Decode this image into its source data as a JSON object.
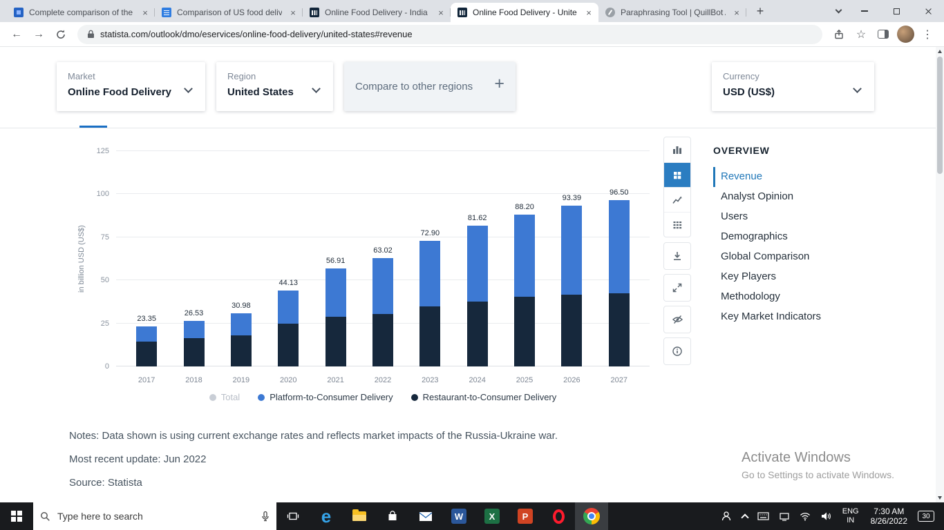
{
  "browser": {
    "tabs": [
      {
        "title": "Complete comparison of the",
        "favicon": "blue-app",
        "active": false
      },
      {
        "title": "Comparison of US food deliv",
        "favicon": "doc",
        "active": false
      },
      {
        "title": "Online Food Delivery - India |",
        "favicon": "statista",
        "active": false
      },
      {
        "title": "Online Food Delivery - Unite",
        "favicon": "statista",
        "active": true
      },
      {
        "title": "Paraphrasing Tool | QuillBot A",
        "favicon": "quillbot",
        "active": false
      }
    ],
    "url": "statista.com/outlook/dmo/eservices/online-food-delivery/united-states#revenue"
  },
  "icons": {
    "tab_close": "×",
    "new_tab": "+",
    "back": "←",
    "forward": "→",
    "star": "☆",
    "menu": "⋮"
  },
  "filters": {
    "market_label": "Market",
    "market_value": "Online Food Delivery",
    "region_label": "Region",
    "region_value": "United States",
    "compare_label": "Compare to other regions",
    "compare_plus": "+",
    "currency_label": "Currency",
    "currency_value": "USD (US$)"
  },
  "chart_data": {
    "type": "bar",
    "stacked": true,
    "ylabel": "in billion USD (US$)",
    "ylim": [
      0,
      125
    ],
    "yticks": [
      0,
      25,
      50,
      75,
      100,
      125
    ],
    "grid": true,
    "legend_position": "bottom",
    "categories": [
      "2017",
      "2018",
      "2019",
      "2020",
      "2021",
      "2022",
      "2023",
      "2024",
      "2025",
      "2026",
      "2027"
    ],
    "series": [
      {
        "name": "Platform-to-Consumer Delivery",
        "color": "#3d79d3",
        "stack_position": "top",
        "values": [
          8.85,
          10.03,
          12.98,
          19.13,
          27.91,
          32.52,
          37.9,
          44.12,
          47.7,
          51.89,
          54.0
        ]
      },
      {
        "name": "Restaurant-to-Consumer Delivery",
        "color": "#16283c",
        "stack_position": "bottom",
        "values": [
          14.5,
          16.5,
          18.0,
          25.0,
          29.0,
          30.5,
          35.0,
          37.5,
          40.5,
          41.5,
          42.5
        ]
      }
    ],
    "totals": [
      "23.35",
      "26.53",
      "30.98",
      "44.13",
      "56.91",
      "63.02",
      "72.90",
      "81.62",
      "88.20",
      "93.39",
      "96.50"
    ],
    "legend": [
      {
        "name": "Total",
        "color": "#c9ced6",
        "disabled": true
      },
      {
        "name": "Platform-to-Consumer Delivery",
        "color": "#3d79d3",
        "disabled": false
      },
      {
        "name": "Restaurant-to-Consumer Delivery",
        "color": "#16283c",
        "disabled": false
      }
    ]
  },
  "sidebar": {
    "heading": "OVERVIEW",
    "items": [
      {
        "label": "Revenue",
        "active": true
      },
      {
        "label": "Analyst Opinion",
        "active": false
      },
      {
        "label": "Users",
        "active": false
      },
      {
        "label": "Demographics",
        "active": false
      },
      {
        "label": "Global Comparison",
        "active": false
      },
      {
        "label": "Key Players",
        "active": false
      },
      {
        "label": "Methodology",
        "active": false
      },
      {
        "label": "Key Market Indicators",
        "active": false
      }
    ]
  },
  "notes": {
    "line1": "Notes: Data shown is using current exchange rates and reflects market impacts of the Russia-Ukraine war.",
    "line2": "Most recent update: Jun 2022",
    "line3": "Source: Statista"
  },
  "watermark": {
    "line1": "Activate Windows",
    "line2": "Go to Settings to activate Windows."
  },
  "taskbar": {
    "search_placeholder": "Type here to search",
    "lang_primary": "ENG",
    "lang_secondary": "IN",
    "time": "7:30 AM",
    "date": "8/26/2022",
    "notification_count": "30"
  }
}
